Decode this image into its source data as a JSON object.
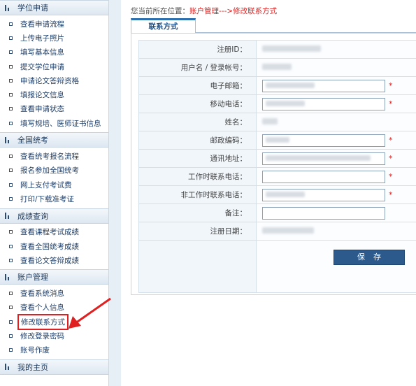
{
  "sidebar": {
    "sections": [
      {
        "title": "学位申请",
        "items": [
          "查看申请流程",
          "上传电子照片",
          "填写基本信息",
          "提交学位申请",
          "申请论文答辩资格",
          "填报论文信息",
          "查看申请状态",
          "填写规培、医师证书信息"
        ]
      },
      {
        "title": "全国统考",
        "items": [
          "查看统考报名流程",
          "报名参加全国统考",
          "网上支付考试费",
          "打印/下载准考证"
        ]
      },
      {
        "title": "成绩查询",
        "items": [
          "查看课程考试成绩",
          "查看全国统考成绩",
          "查看论文答辩成绩"
        ]
      },
      {
        "title": "账户管理",
        "items": [
          "查看系统消息",
          "查看个人信息",
          "修改联系方式",
          "修改登录密码",
          "账号作废"
        ]
      },
      {
        "title": "我的主页",
        "items": []
      }
    ],
    "active_item": "修改联系方式"
  },
  "breadcrumb": {
    "prefix": "您当前所在位置：",
    "location": "账户管理--->修改联系方式"
  },
  "tab": {
    "label": "联系方式"
  },
  "form": {
    "rows": [
      {
        "label": "注册ID：",
        "type": "text",
        "required": false
      },
      {
        "label": "用户名 / 登录帐号：",
        "type": "text",
        "required": false
      },
      {
        "label": "电子邮箱：",
        "type": "input",
        "required": true
      },
      {
        "label": "移动电话：",
        "type": "input",
        "required": true
      },
      {
        "label": "姓名：",
        "type": "text",
        "required": false
      },
      {
        "label": "邮政编码：",
        "type": "input",
        "required": true
      },
      {
        "label": "通讯地址：",
        "type": "input",
        "required": true
      },
      {
        "label": "工作时联系电话：",
        "type": "input",
        "required": true
      },
      {
        "label": "非工作时联系电话：",
        "type": "input",
        "required": true
      },
      {
        "label": "备注：",
        "type": "input",
        "required": false
      },
      {
        "label": "注册日期：",
        "type": "text",
        "required": false
      }
    ],
    "required_mark": "*",
    "save_label": "保存"
  },
  "colors": {
    "accent": "#2c5a8c",
    "alert": "#e02020"
  }
}
